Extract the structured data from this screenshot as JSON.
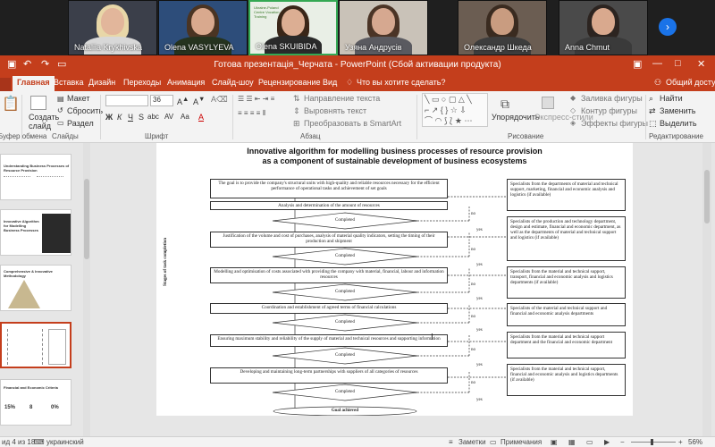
{
  "meeting": {
    "participants": [
      {
        "name": "Nataliia Krykhivska",
        "bg": "#3b3f4a",
        "skin": "#e2b69b",
        "hair": "#e8d7a8",
        "shirt": "#d8d8d8"
      },
      {
        "name": "Olena VASYLYEVA",
        "bg": "#2d4d7a",
        "skin": "#d9a98e",
        "hair": "#4a3423",
        "shirt": "#25331f"
      },
      {
        "name": "Olena SKUIBIDA",
        "bg": "#e9efe6",
        "skin": "#dcae93",
        "hair": "#3a2618",
        "shirt": "#2a2a2a"
      },
      {
        "name": "Узяна Андрусів",
        "bg": "#c9c2b8",
        "skin": "#d6a890",
        "hair": "#4b3426",
        "shirt": "#5a5a60"
      },
      {
        "name": "Олександр Шкеда",
        "bg": "#6b5d52",
        "skin": "#c99c80",
        "hair": "#3a2b20",
        "shirt": "#3d3d3d"
      },
      {
        "name": "Anna Chmut",
        "bg": "#4a4a4a",
        "skin": "#d9a98e",
        "hair": "#2c2420",
        "shirt": "#3a3a3a"
      }
    ],
    "logo_text": "Ukraine-Poland Centre Vocation and Training",
    "next_icon": "chevron-right-icon"
  },
  "window": {
    "title": "Готова презентація_Черчата - PowerPoint (Сбой активации продукта)",
    "accent": "#c43e1c"
  },
  "ribbon": {
    "tabs": [
      "Главная",
      "Вставка",
      "Дизайн",
      "Переходы",
      "Анимация",
      "Слайд-шоу",
      "Рецензирование",
      "Вид"
    ],
    "tell_me": "Что вы хотите сделать?",
    "share": "Общий доступ",
    "clipboard": {
      "paste": "Вставить",
      "group": "Буфер обмена"
    },
    "slides": {
      "create": "Создать слайд",
      "layout": "Макет",
      "reset": "Сбросить",
      "section": "Раздел",
      "group": "Слайды"
    },
    "font": {
      "size": "36",
      "group": "Шрифт",
      "bold": "Ж",
      "italic": "К",
      "underline": "Ч",
      "strike": "S",
      "shadow": "abc",
      "spacing": "AV",
      "case": "Aa"
    },
    "paragraph": {
      "direction": "Направление текста",
      "align": "Выровнять текст",
      "smartart": "Преобразовать в SmartArt",
      "group": "Абзац"
    },
    "drawing": {
      "arrange": "Упорядочить",
      "styles": "Экспресс-стили",
      "fill": "Заливка фигуры",
      "outline": "Контур фигуры",
      "effects": "Эффекты фигуры",
      "group": "Рисование"
    },
    "editing": {
      "find": "Найти",
      "replace": "Заменить",
      "select": "Выделить",
      "group": "Редактирование"
    }
  },
  "thumbnails": [
    {
      "title": "Understanding Business Processes of Resource Provision"
    },
    {
      "title": "Innovative Algorithm for Modelling Business Processes"
    },
    {
      "title": "Comprehensive & Innovative Methodology"
    },
    {
      "title": ""
    },
    {
      "title": "Financial and Economic Criteria",
      "v1": "15%",
      "v2": "8",
      "v3": "0%"
    }
  ],
  "slide": {
    "title_line1": "Innovative algorithm for modelling business processes of resource provision",
    "title_line2": "as a component of sustainable development of business ecosystems",
    "vertical_label": "Stages of task completion",
    "steps": [
      "The goal is to provide the company's structural units with high-quality and reliable resources necessary for the efficient performance of operational tasks and achievement of set goals",
      "Analysis and determination of the amount of resources",
      "Justification of the volume and cost of purchases, analysis of material quality indicators, setting the timing of their production and shipment",
      "Modelling and optimisation of costs associated with providing the company with material, financial, labour and information resources",
      "Coordination and establishment of agreed terms of financial calculations",
      "Ensuring maximum stability and reliability of the supply of material and technical resources and supporting information",
      "Developing and maintaining long-term partnerships with suppliers of all categories of resources"
    ],
    "completed": "Completed",
    "goal": "Goal achieved",
    "yes": "yes",
    "no": "no",
    "side_boxes": [
      "Specialists from the departments of material and technical support, marketing, financial and economic analysis and logistics (if available)",
      "Specialists of the production and technology department, design and estimate, financial and economic department, as well as the departments of material and technical support and logistics (if available)",
      "Specialists from the material and technical support, transport, financial and economic analysis and logistics departments (if available)",
      "Specialists of the material and technical support and financial and economic analysis departments",
      "Specialists from the material and technical support department and the financial and economic department",
      "Specialists from the material and technical support, financial and economic analysis and logistics departments (if available)"
    ]
  },
  "status": {
    "slide_of": "ид 4 из 18",
    "language": "украинский",
    "notes": "Заметки",
    "comments": "Примечания",
    "zoom": "56%"
  }
}
